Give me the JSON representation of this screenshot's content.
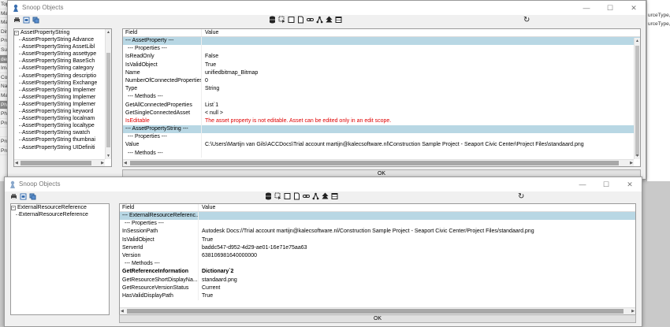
{
  "background_app": {
    "left_labels": [
      "Top",
      "Mat",
      "Ma",
      "Dim",
      "Pro",
      "Sur",
      "der",
      "Ima",
      "Cor",
      "Na",
      "Ma",
      "Pha",
      "Pha",
      "Proj",
      "",
      "Proj",
      "Proj"
    ],
    "right_labels": [
      "urceType,",
      "urceType,"
    ]
  },
  "window1": {
    "title": "Snoop Objects",
    "tree": {
      "root": "AssetPropertyString",
      "children": [
        "AssetPropertyString  Advance",
        "AssetPropertyString  AssetLibl",
        "AssetPropertyString  assettype",
        "AssetPropertyString  BaseSch",
        "AssetPropertyString  category",
        "AssetPropertyString  descriptio",
        "AssetPropertyString  Exchange",
        "AssetPropertyString  Implemer",
        "AssetPropertyString  Implemer",
        "AssetPropertyString  Implemer",
        "AssetPropertyString  keyword",
        "AssetPropertyString  localnam",
        "AssetPropertyString  localtype",
        "AssetPropertyString  swatch",
        "AssetPropertyString  thumbnai",
        "AssetPropertyString  UIDefiniti"
      ]
    },
    "grid": {
      "headers": [
        "Field",
        "Value"
      ],
      "rows": [
        {
          "field": "--- AssetProperty ---",
          "value": "",
          "kind": "section"
        },
        {
          "field": "--- Properties ---",
          "value": "",
          "kind": "sub"
        },
        {
          "field": "IsReadOnly",
          "value": "False",
          "kind": ""
        },
        {
          "field": "IsValidObject",
          "value": "True",
          "kind": ""
        },
        {
          "field": "Name",
          "value": "unifiedbitmap_Bitmap",
          "kind": ""
        },
        {
          "field": "NumberOfConnectedProperties",
          "value": "0",
          "kind": ""
        },
        {
          "field": "Type",
          "value": "String",
          "kind": ""
        },
        {
          "field": "--- Methods ---",
          "value": "",
          "kind": "sub"
        },
        {
          "field": "GetAllConnectedProperties",
          "value": "List`1",
          "kind": ""
        },
        {
          "field": "GetSingleConnectedAsset",
          "value": "< null >",
          "kind": ""
        },
        {
          "field": "IsEditable",
          "value": "The asset property is not editable. Asset can be edited only in an edit scope.",
          "kind": "red"
        },
        {
          "field": "--- AssetPropertyString ---",
          "value": "",
          "kind": "section"
        },
        {
          "field": "--- Properties ---",
          "value": "",
          "kind": "sub"
        },
        {
          "field": "Value",
          "value": "C:\\Users\\Martijn van Gils\\ACCDocs\\Trial account martijn@kalecsoftware.nl\\Construction  Sample Project - Seaport Civic Center\\Project Files\\standaard.png",
          "kind": ""
        },
        {
          "field": "--- Methods ---",
          "value": "",
          "kind": "sub"
        }
      ]
    },
    "ok_label": "OK"
  },
  "window2": {
    "title": "Snoop Objects",
    "tree": {
      "root": "ExternalResourceReference",
      "children": [
        "ExternalResourceReference"
      ]
    },
    "grid": {
      "headers": [
        "Field",
        "Value"
      ],
      "rows": [
        {
          "field": "--- ExternalResourceReferenc...",
          "value": "",
          "kind": "section"
        },
        {
          "field": "--- Properties ---",
          "value": "",
          "kind": "sub"
        },
        {
          "field": "InSessionPath",
          "value": "Autodesk Docs://Trial account martijn@kalecsoftware.nl/Construction  Sample Project - Seaport Civic Center/Project Files/standaard.png",
          "kind": ""
        },
        {
          "field": "IsValidObject",
          "value": "True",
          "kind": ""
        },
        {
          "field": "ServerId",
          "value": "baddc547-d952-4d29-ae01-16e71e75aa63",
          "kind": ""
        },
        {
          "field": "Version",
          "value": "638106981640000000",
          "kind": ""
        },
        {
          "field": "--- Methods ---",
          "value": "",
          "kind": "sub"
        },
        {
          "field": "GetReferenceInformation",
          "value": "Dictionary`2",
          "kind": "bold"
        },
        {
          "field": "GetResourceShortDisplayNa...",
          "value": "standaard.png",
          "kind": ""
        },
        {
          "field": "GetResourceVersionStatus",
          "value": "Current",
          "kind": ""
        },
        {
          "field": "HasValidDisplayPath",
          "value": "True",
          "kind": ""
        }
      ]
    },
    "ok_label": "OK"
  },
  "colors": {
    "section_row": "#b8d7e4",
    "error_text": "#e00000",
    "dialog_bg": "#f0f0f0"
  },
  "icons": {
    "app": "snoop-app-icon",
    "left_toolbar": [
      "print-icon",
      "print-preview-icon",
      "copy-icon"
    ],
    "mid_toolbar": [
      "database-icon",
      "select-object-icon",
      "view-icon",
      "document-icon",
      "link-icon",
      "network-icon",
      "tree-icon",
      "table-icon"
    ],
    "refresh": "refresh-icon"
  }
}
